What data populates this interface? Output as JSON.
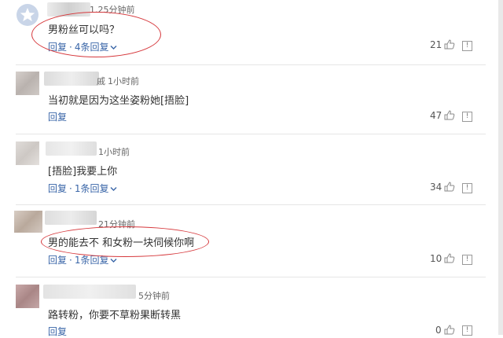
{
  "colors": {
    "link": "#3a66a8",
    "annotation": "#d6383c",
    "divider": "#e6e6e6"
  },
  "comments": [
    {
      "time": "1.25分钟前",
      "partial_name": "",
      "text": "男粉丝可以吗？",
      "reply_label": "回复",
      "sub_replies": "4条回复",
      "likes": "21"
    },
    {
      "time": "1小时前",
      "partial_name": "戚",
      "text": "当初就是因为这坐姿粉她[捂脸]",
      "reply_label": "回复",
      "sub_replies": "",
      "likes": "47"
    },
    {
      "time": "1小时前",
      "partial_name": "",
      "text": "[捂脸]我要上你",
      "reply_label": "回复",
      "sub_replies": "1条回复",
      "likes": "34"
    },
    {
      "time": "21分钟前",
      "partial_name": "",
      "text": "男的能去不 和女粉一块伺候你啊",
      "reply_label": "回复",
      "sub_replies": "1条回复",
      "likes": "10"
    },
    {
      "time": "5分钟前",
      "partial_name": "",
      "text": "路转粉，你要不草粉果断转黑",
      "reply_label": "回复",
      "sub_replies": "",
      "likes": "0"
    }
  ],
  "icons": {
    "like": "thumbs-up-icon",
    "report": "report-icon",
    "chevron": "chevron-down-icon",
    "default_avatar": "star-avatar-icon"
  }
}
